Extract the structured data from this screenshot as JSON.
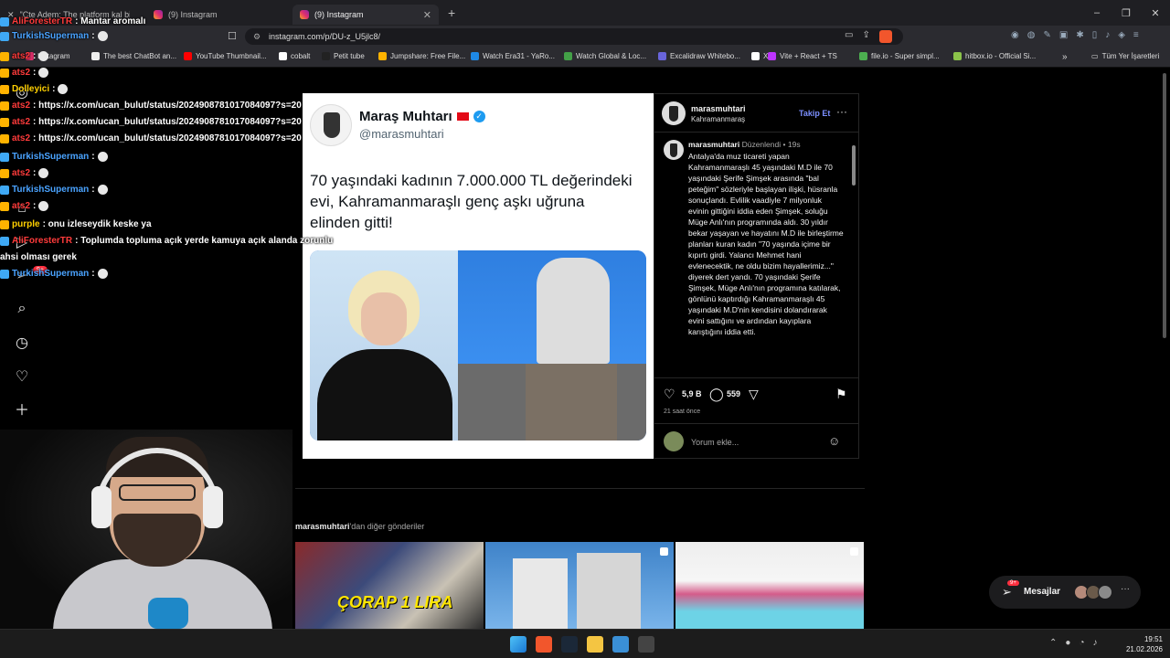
{
  "browser": {
    "tabs": [
      {
        "label": "\"Çte Adem: The platform kal bilmem"
      },
      {
        "label": "(9) Instagram"
      },
      {
        "label": "(9) Instagram"
      }
    ],
    "url": "instagram.com/p/DU-z_U5jlc8/",
    "bookmarks": [
      {
        "label": "Instagram",
        "color": "#e1306c"
      },
      {
        "label": "The best ChatBot an...",
        "color": "#eeeeee"
      },
      {
        "label": "YouTube Thumbnail...",
        "color": "#ff0000"
      },
      {
        "label": "cobalt",
        "color": "#ffffff"
      },
      {
        "label": "Petit tube",
        "color": "#222222"
      },
      {
        "label": "Jumpshare: Free File...",
        "color": "#ffb300"
      },
      {
        "label": "Watch Era31 - YaRo...",
        "color": "#1e88e5"
      },
      {
        "label": "Watch Global & Loc...",
        "color": "#43a047"
      },
      {
        "label": "Excalidraw Whitebo...",
        "color": "#6965db"
      },
      {
        "label": "X",
        "color": "#ffffff"
      },
      {
        "label": "Vite + React + TS",
        "color": "#bd34fe"
      },
      {
        "label": "file.io - Super simpl...",
        "color": "#4caf50"
      },
      {
        "label": "hitbox.io - Official Si...",
        "color": "#8bc34a"
      }
    ],
    "all_bookmarks": "Tüm Yer İşaretleri"
  },
  "chat": [
    {
      "user": "AliForesterTR",
      "user_color": "red",
      "text": ": Mantar aromalı",
      "badge_color": "#3fa9f5"
    },
    {
      "user": "TurkishSuperman",
      "user_color": "blue",
      "text": ":",
      "badge_color": "#3fa9f5"
    },
    {
      "user": "ats2",
      "user_color": "red",
      "text": ":",
      "badge_color": "#ffb300"
    },
    {
      "user": "ats2",
      "user_color": "red",
      "text": ":",
      "badge_color": "#ffb300"
    },
    {
      "user": "Dolleyici",
      "user_color": "yellow",
      "text": ":",
      "badge_color": "#ffb300"
    },
    {
      "user": "ats2",
      "user_color": "red",
      "text": ": https://x.com/ucan_bulut/status/2024908781017084097?s=20",
      "badge_color": "#ffb300"
    },
    {
      "user": "ats2",
      "user_color": "red",
      "text": ": https://x.com/ucan_bulut/status/2024908781017084097?s=20",
      "badge_color": "#ffb300"
    },
    {
      "user": "ats2",
      "user_color": "red",
      "text": ": https://x.com/ucan_bulut/status/2024908781017084097?s=20",
      "badge_color": "#ffb300"
    },
    {
      "user": "TurkishSuperman",
      "user_color": "blue",
      "text": ":",
      "badge_color": "#3fa9f5"
    },
    {
      "user": "ats2",
      "user_color": "red",
      "text": ":",
      "badge_color": "#ffb300"
    },
    {
      "user": "TurkishSuperman",
      "user_color": "blue",
      "text": ":",
      "badge_color": "#3fa9f5"
    },
    {
      "user": "ats2",
      "user_color": "red",
      "text": ":",
      "badge_color": "#ffb300"
    },
    {
      "user": "purple",
      "user_color": "yellow",
      "text": ": onu izleseydik keske ya",
      "badge_color": "#ffb300"
    },
    {
      "user": "AliForesterTR",
      "user_color": "red",
      "text": ": Toplumda topluma açık yerde kamuya açık alanda zorunlu",
      "badge_color": "#3fa9f5"
    },
    {
      "user": "",
      "user_color": "white",
      "text": "ahsi olması gerek",
      "badge_color": ""
    },
    {
      "user": "TurkishSuperman",
      "user_color": "blue",
      "text": ":",
      "badge_color": "#3fa9f5"
    }
  ],
  "nav": {
    "notif_badge": "9+"
  },
  "tweet": {
    "name": "Maraş Muhtarı",
    "handle": "@marasmuhtari",
    "text": "70 yaşındaki kadının 7.000.000 TL değerindeki evi, Kahramanmaraşlı genç aşkı uğruna elinden gitti!"
  },
  "post": {
    "username": "marasmuhtari",
    "location": "Kahramanmaraş",
    "follow": "Takip Et",
    "caption_user": "marasmuhtari",
    "edited": "Düzenlendi",
    "caption_time": "19s",
    "caption": "Antalya'da muz ticareti yapan Kahramanmaraşlı 45 yaşındaki M.D ile 70 yaşındaki Şerife Şimşek arasında \"bal peteğim\" sözleriyle başlayan ilişki, hüsranla sonuçlandı. Evlilik vaadiyle 7 milyonluk evinin gittiğini iddia eden Şimşek, soluğu Müge Anlı'nın programında aldı. 30 yıldır bekar yaşayan ve hayatını M.D ile birleştirme planları kuran kadın \"70 yaşında içime bir kıpırtı girdi. Yalancı Mehmet hani evlenecektik, ne oldu bizim hayallerimiz...\" diyerek dert yandı. 70 yaşındaki Şerife Şimşek, Müge Anlı'nın programına katılarak, gönlünü kaptırdığı Kahramanmaraşlı 45 yaşındaki M.D'nin kendisini dolandırarak evini sattığını ve ardından kayıplara karıştığını iddia etti.",
    "likes": "5,9 B",
    "comments": "559",
    "posted": "21 saat önce",
    "comment_placeholder": "Yorum ekle..."
  },
  "more": {
    "user": "marasmuhtari",
    "suffix": "'dan diğer gönderiler",
    "thumb1_text": "ÇORAP 1 LIRA"
  },
  "messages": {
    "label": "Mesajlar",
    "badge": "9+"
  },
  "taskbar": {
    "time": "19:51",
    "date": "21.02.2026"
  }
}
